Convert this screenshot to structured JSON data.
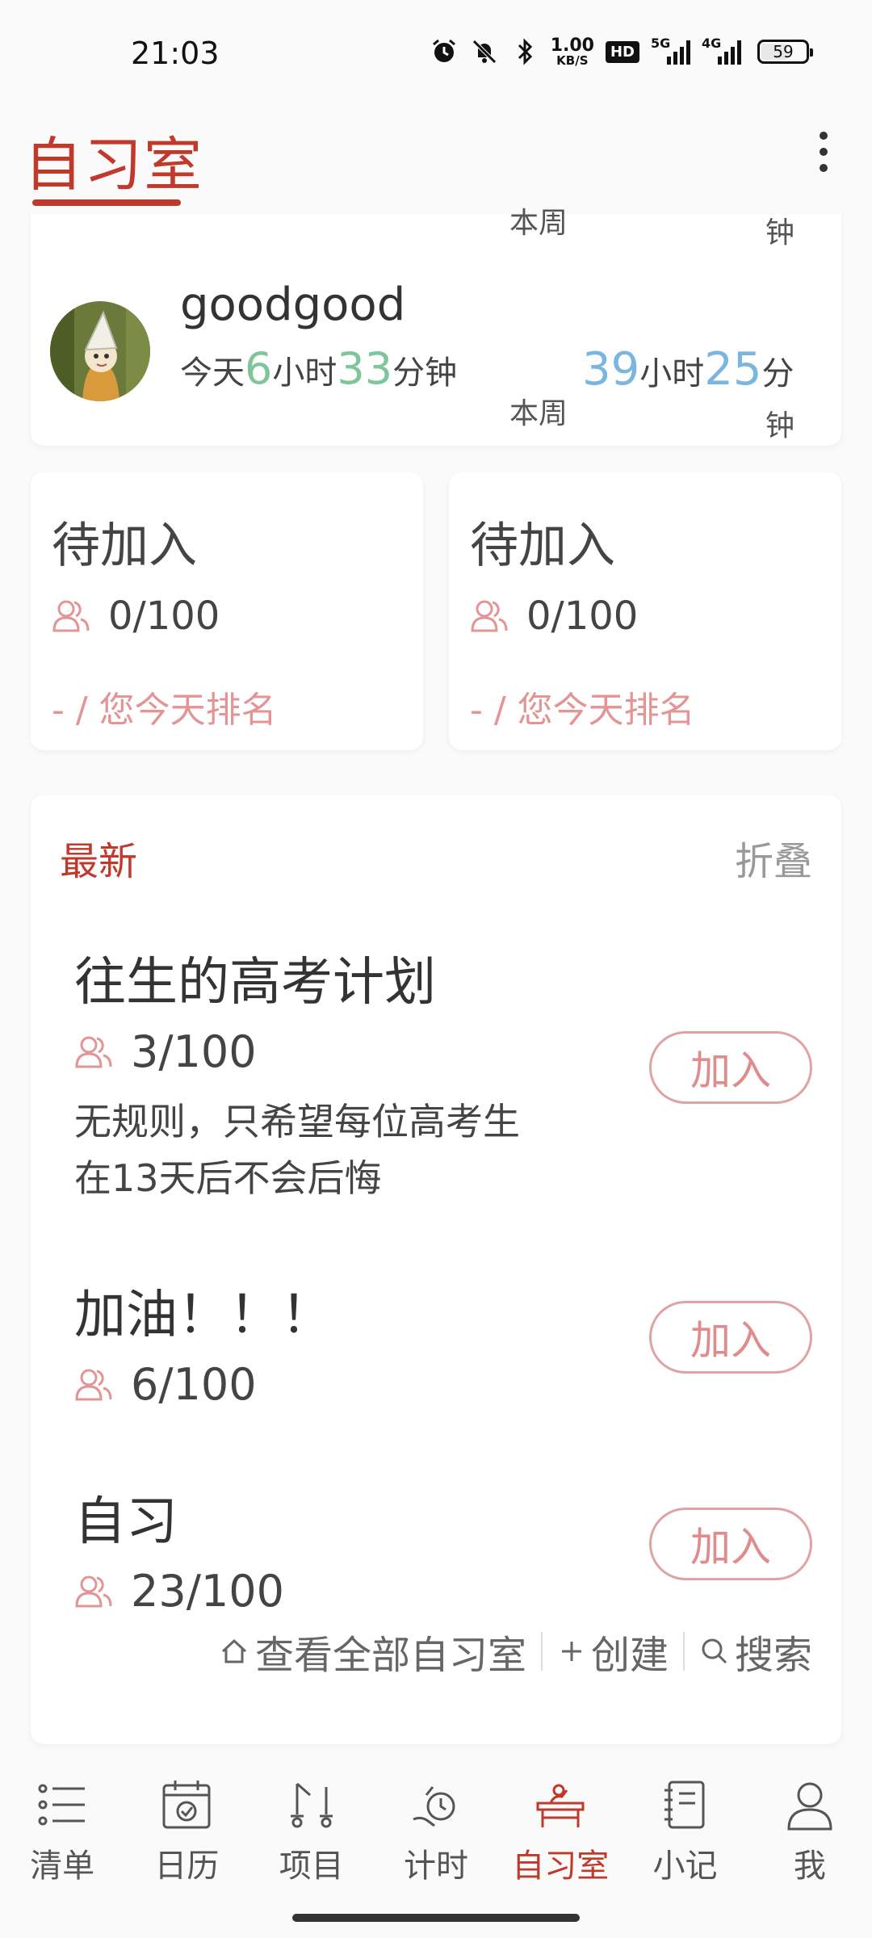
{
  "status_bar": {
    "time": "21:03",
    "speed_value": "1.00",
    "speed_unit": "KB/S",
    "hd_label": "HD",
    "signal1_label": "5G",
    "signal2_label": "4G",
    "battery": "59"
  },
  "header": {
    "title": "自习室"
  },
  "user_card": {
    "week_top_label": "本周",
    "minutes_top_label": "钟",
    "username": "goodgood",
    "today_prefix": "今天",
    "today_hours": "6",
    "today_hours_unit": "小时",
    "today_minutes": "33",
    "today_minutes_unit": "分钟",
    "week_hours": "39",
    "week_hours_unit": "小时",
    "week_minutes": "25",
    "week_minutes_unit": "分",
    "week_bottom_label": "本周",
    "minutes_bottom_label": "钟"
  },
  "pending_rooms": [
    {
      "title": "待加入",
      "count": "0/100",
      "rank": "- / 您今天排名"
    },
    {
      "title": "待加入",
      "count": "0/100",
      "rank": "- / 您今天排名"
    }
  ],
  "latest": {
    "title": "最新",
    "fold_label": "折叠",
    "rooms": [
      {
        "title": "往生的高考计划",
        "count": "3/100",
        "desc_line1": "无规则，只希望每位高考生",
        "desc_line2": "在13天后不会后悔",
        "join_label": "加入"
      },
      {
        "title": "加油！！！",
        "count": "6/100",
        "join_label": "加入"
      },
      {
        "title": "自习",
        "count": "23/100",
        "join_label": "加入"
      }
    ],
    "footer": {
      "view_all": "查看全部自习室",
      "create": "创建",
      "search": "搜索"
    }
  },
  "bottom_nav": [
    {
      "label": "清单",
      "icon": "list-icon"
    },
    {
      "label": "日历",
      "icon": "calendar-icon"
    },
    {
      "label": "项目",
      "icon": "project-icon"
    },
    {
      "label": "计时",
      "icon": "timer-icon"
    },
    {
      "label": "自习室",
      "icon": "study-room-icon",
      "active": true
    },
    {
      "label": "小记",
      "icon": "notebook-icon"
    },
    {
      "label": "我",
      "icon": "profile-icon"
    }
  ],
  "colors": {
    "accent": "#c0392b",
    "green_number": "#7ec59a",
    "blue_number": "#7ab6e0",
    "pink_join": "#e08c8c"
  }
}
